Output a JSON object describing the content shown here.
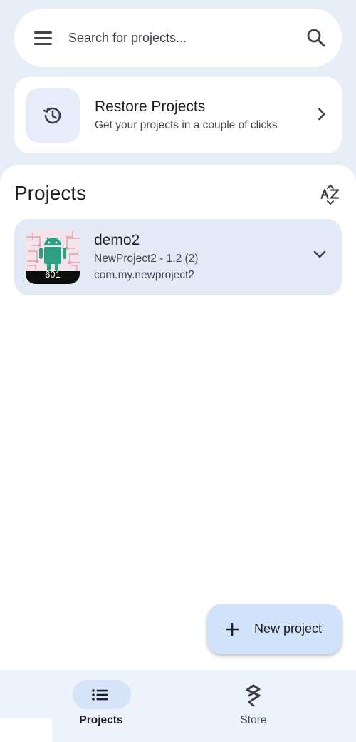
{
  "search": {
    "placeholder": "Search for projects..."
  },
  "restore": {
    "title": "Restore Projects",
    "subtitle": "Get your projects in a couple of clicks"
  },
  "projects": {
    "heading": "Projects",
    "sort_icon": "sort-az-icon",
    "items": [
      {
        "name": "demo2",
        "version_line": "NewProject2 - 1.2 (2)",
        "package": "com.my.newproject2",
        "thumb_label": "601"
      }
    ]
  },
  "fab": {
    "label": "New project",
    "icon": "plus-icon"
  },
  "nav": {
    "items": [
      {
        "label": "Projects",
        "icon": "list-icon",
        "active": true
      },
      {
        "label": "Store",
        "icon": "store-icon",
        "active": false
      }
    ]
  },
  "colors": {
    "background": "#e7eef8",
    "surface": "#ffffff",
    "card_tint": "#e3eaf5",
    "fab": "#d0e3fb",
    "nav_pill": "#d6e4fa",
    "android_green": "#2e9e84"
  }
}
